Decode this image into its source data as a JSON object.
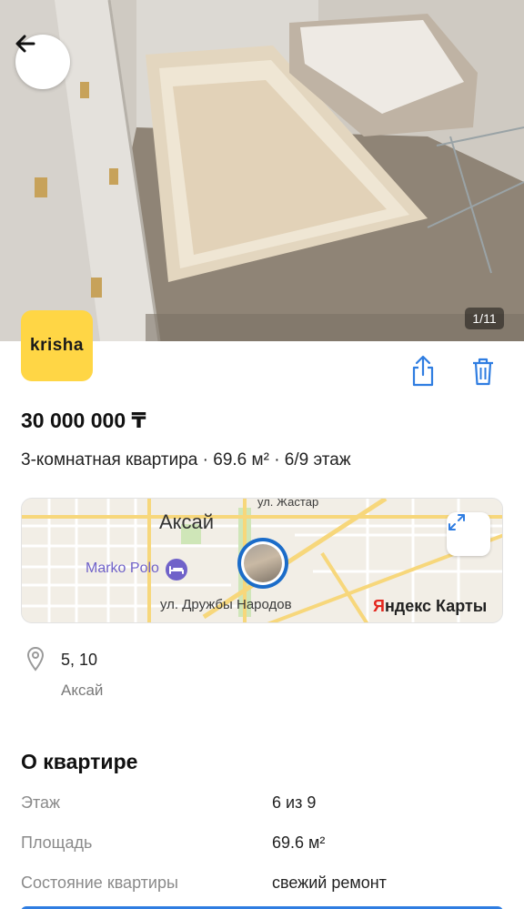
{
  "header": {
    "back_icon": "arrow-left-icon",
    "photo_counter": "1/11"
  },
  "brand": {
    "logo_text": "krisha"
  },
  "actions": {
    "share_icon": "share-icon",
    "delete_icon": "trash-icon"
  },
  "listing": {
    "price": "30 000 000 ₸",
    "subtitle": "3-комнатная квартира · 69.6 м² · 6/9 этаж"
  },
  "map": {
    "city": "Аксай",
    "street_top": "ул. Жастар",
    "street_bottom": "ул. Дружбы Народов",
    "poi": "Marko Polo",
    "provider_prefix": "Я",
    "provider_rest": "ндекс Карты",
    "expand_icon": "expand-icon"
  },
  "address": {
    "line1": "5, 10",
    "city": "Аксай",
    "icon": "location-pin-icon"
  },
  "details": {
    "title": "О квартире",
    "rows": [
      {
        "label": "Этаж",
        "value": "6 из 9"
      },
      {
        "label": "Площадь",
        "value": "69.6 м²"
      },
      {
        "label": "Состояние квартиры",
        "value": "свежий ремонт"
      }
    ]
  },
  "colors": {
    "accent": "#2f7de1",
    "logo_bg": "#ffd645",
    "map_pin": "#1b6cc9",
    "poi": "#7062c9",
    "brand_red": "#e3261d"
  }
}
